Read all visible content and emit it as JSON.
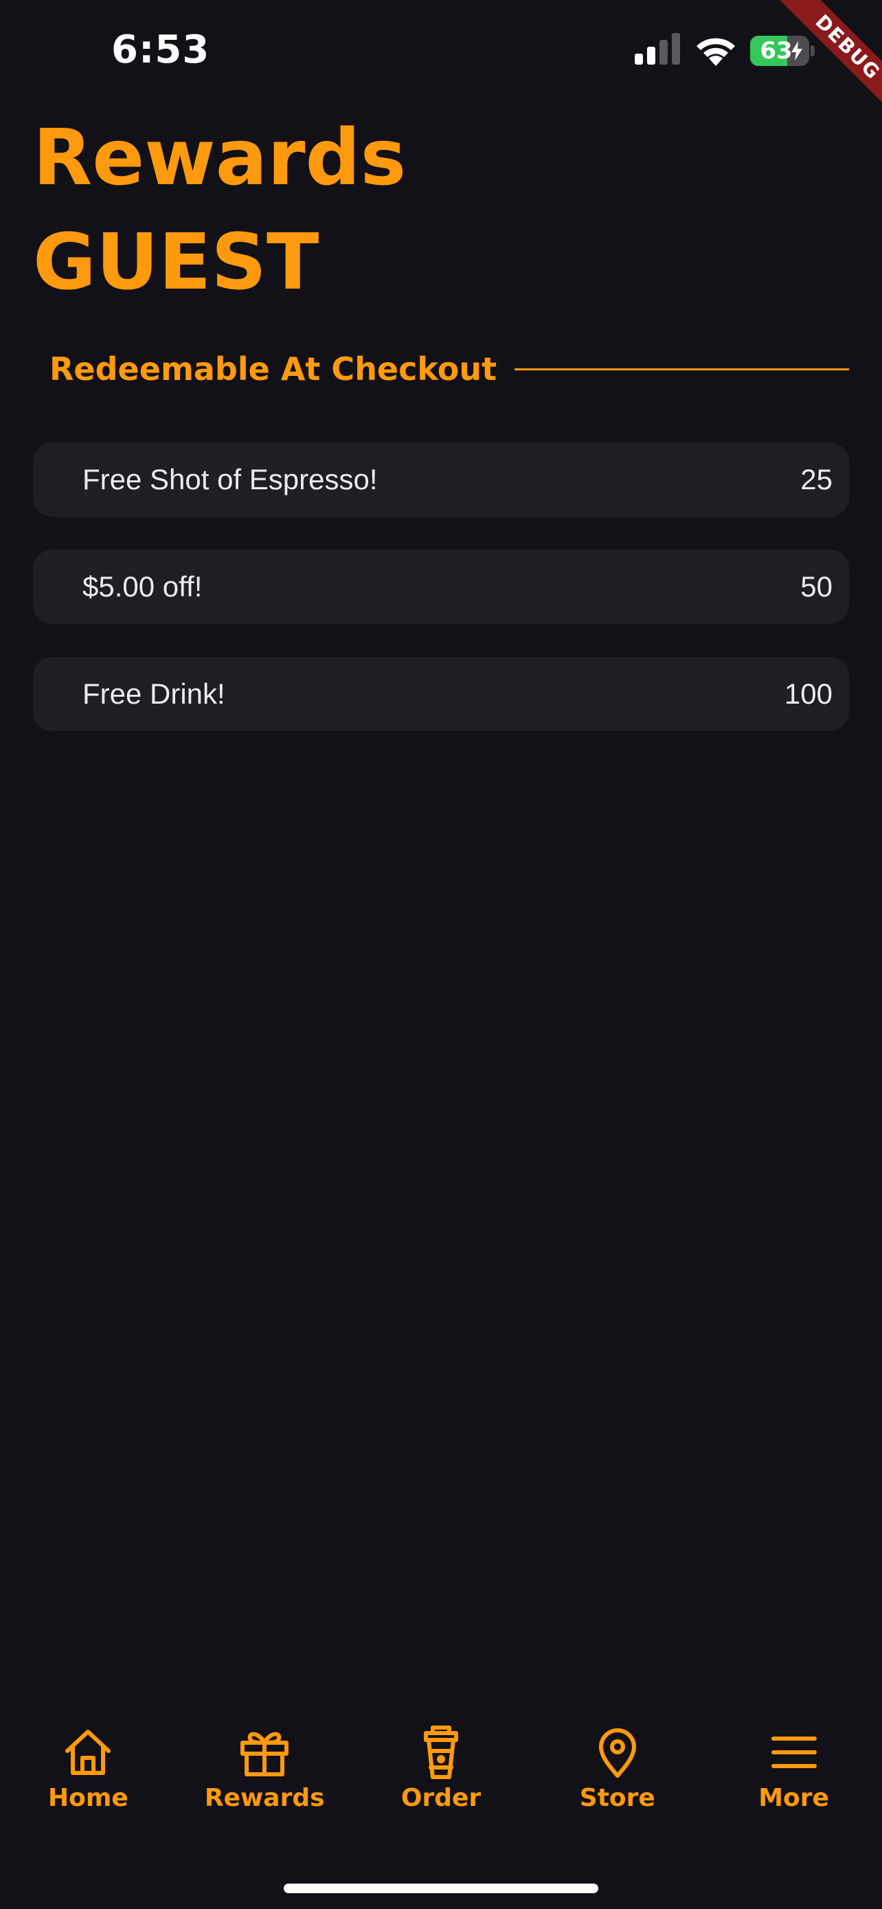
{
  "status_bar": {
    "time": "6:53",
    "battery_percent": 63,
    "battery_label": "63",
    "signal_icon": "cellular-signal-icon",
    "wifi_icon": "wifi-icon"
  },
  "debug_banner": {
    "label": "DEBUG"
  },
  "header": {
    "title": "Rewards",
    "user_name": "GUEST"
  },
  "section": {
    "title": "Redeemable At Checkout"
  },
  "rewards": [
    {
      "name": "Free Shot of Espresso!",
      "points": "25"
    },
    {
      "name": "$5.00 off!",
      "points": "50"
    },
    {
      "name": "Free Drink!",
      "points": "100"
    }
  ],
  "bottom_nav": {
    "items": [
      {
        "label": "Home",
        "icon": "home-icon"
      },
      {
        "label": "Rewards",
        "icon": "gift-icon"
      },
      {
        "label": "Order",
        "icon": "coffee-cup-icon"
      },
      {
        "label": "Store",
        "icon": "map-pin-icon"
      },
      {
        "label": "More",
        "icon": "menu-icon"
      }
    ]
  },
  "colors": {
    "background": "#131118",
    "accent": "#ff9a0f",
    "card": "#1f1e24",
    "text": "#ececf0",
    "battery": "#34c759",
    "debug": "#8b1a1d"
  }
}
